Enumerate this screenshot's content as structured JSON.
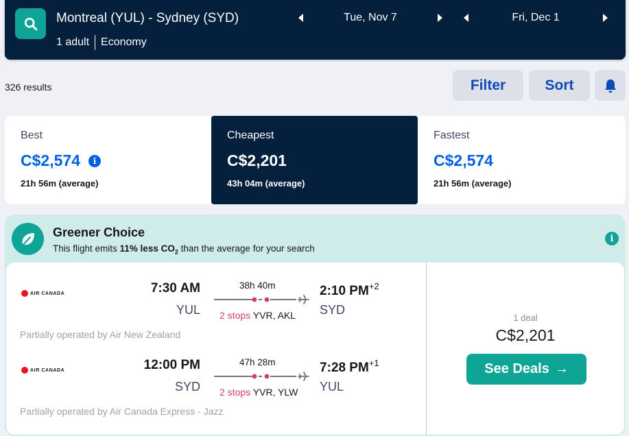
{
  "header": {
    "route": "Montreal (YUL) - Sydney (SYD)",
    "passengers": "1 adult",
    "cabin": "Economy",
    "depart_date": "Tue, Nov 7",
    "return_date": "Fri, Dec 1",
    "search_icon": "search-icon"
  },
  "toolbar": {
    "results_count": "326 results",
    "filter_label": "Filter",
    "sort_label": "Sort",
    "alert_icon": "bell-icon"
  },
  "sort_tabs": [
    {
      "label": "Best",
      "price": "C$2,574",
      "duration": "21h 56m (average)",
      "active": false,
      "has_info": true
    },
    {
      "label": "Cheapest",
      "price": "C$2,201",
      "duration": "43h 04m (average)",
      "active": true,
      "has_info": false
    },
    {
      "label": "Fastest",
      "price": "C$2,574",
      "duration": "21h 56m (average)",
      "active": false,
      "has_info": false
    }
  ],
  "greener": {
    "title": "Greener Choice",
    "sub_prefix": "This flight emits ",
    "sub_bold": "11% less CO",
    "sub_subscript": "2",
    "sub_suffix": " than the average for your search",
    "icon": "leaf-icon"
  },
  "flight": {
    "legs": [
      {
        "airline": "AIR CANADA",
        "depart_time": "7:30 AM",
        "depart_airport": "YUL",
        "duration": "38h 40m",
        "stops_label": "2 stops",
        "stops_airports": "YVR, AKL",
        "arrive_time": "2:10 PM",
        "day_offset": "+2",
        "arrive_airport": "SYD",
        "operated_by": "Partially operated by Air New Zealand"
      },
      {
        "airline": "AIR CANADA",
        "depart_time": "12:00 PM",
        "depart_airport": "SYD",
        "duration": "47h 28m",
        "stops_label": "2 stops",
        "stops_airports": "YVR, YLW",
        "arrive_time": "7:28 PM",
        "day_offset": "+1",
        "arrive_airport": "YUL",
        "operated_by": "Partially operated by Air Canada Express - Jazz"
      }
    ],
    "deal_count": "1 deal",
    "price": "C$2,201",
    "cta_label": "See Deals",
    "cta_arrow": "→"
  },
  "colors": {
    "navy": "#05203c",
    "teal": "#0ea597",
    "blue": "#0062e3",
    "stop_red": "#d1435b",
    "green_bg": "#cfecea"
  }
}
